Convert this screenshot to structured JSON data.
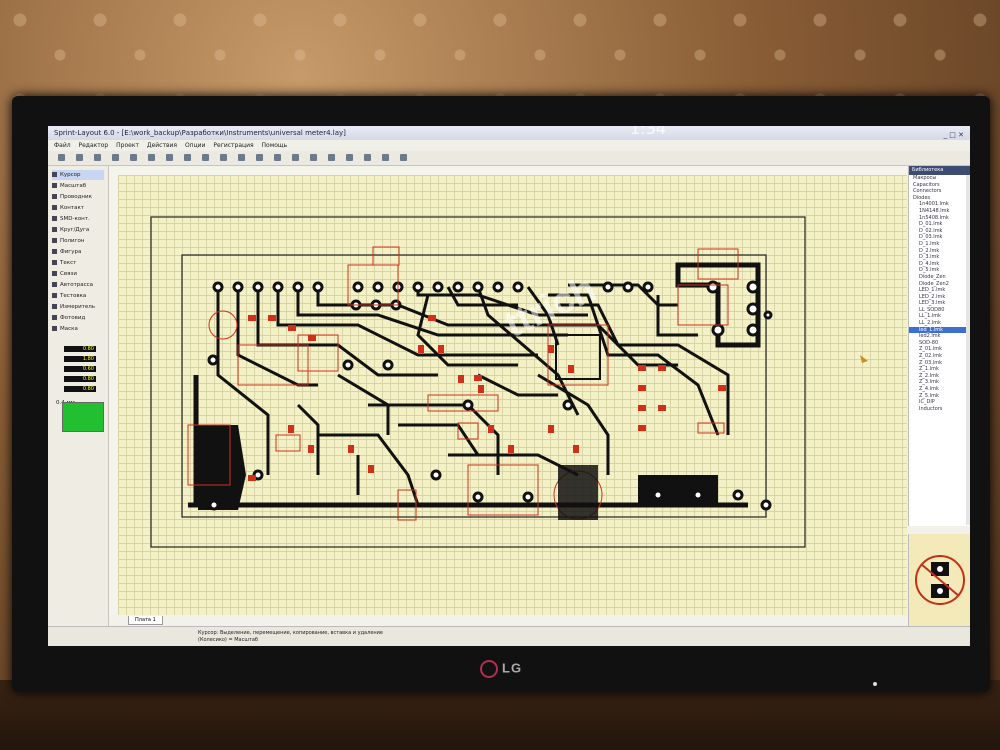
{
  "window": {
    "title": "Sprint-Layout 6.0 - [E:\\work_backup\\Разработки\\Instruments\\universal meter4.lay]",
    "clock": "1:34",
    "controls": "_ □ ✕"
  },
  "menu": [
    "Файл",
    "Редактор",
    "Проект",
    "Действия",
    "Опции",
    "Регистрация",
    "Помощь"
  ],
  "toolbar": {
    "icons": [
      "new-icon",
      "open-icon",
      "save-icon",
      "print-icon",
      "undo-icon",
      "redo-icon",
      "cut-icon",
      "copy-icon",
      "paste-icon",
      "delete-icon",
      "rotate-icon",
      "mirror-icon",
      "align-icon",
      "group-icon",
      "zoom-icon",
      "layer-icon",
      "grid-icon",
      "photo-icon",
      "info-icon",
      "settings-icon"
    ]
  },
  "tools": [
    {
      "label": "Курсор",
      "icon": "cursor-icon",
      "active": true
    },
    {
      "label": "Масштаб",
      "icon": "zoom-icon"
    },
    {
      "label": "Проводник",
      "icon": "track-icon"
    },
    {
      "label": "Контакт",
      "icon": "pad-icon"
    },
    {
      "label": "SMD-конт.",
      "icon": "smd-icon"
    },
    {
      "label": "Круг/Дуга",
      "icon": "circle-icon"
    },
    {
      "label": "Полигон",
      "icon": "polygon-icon"
    },
    {
      "label": "Фигура",
      "icon": "shape-icon"
    },
    {
      "label": "Текст",
      "icon": "text-icon"
    },
    {
      "label": "Связи",
      "icon": "connection-icon"
    },
    {
      "label": "Автотрасса",
      "icon": "autoroute-icon"
    },
    {
      "label": "Тестовка",
      "icon": "test-icon"
    },
    {
      "label": "Измеритель",
      "icon": "measure-icon"
    },
    {
      "label": "Фотовид",
      "icon": "photoview-icon"
    },
    {
      "label": "Маска",
      "icon": "mask-icon"
    }
  ],
  "grid_label": "0.4 мм",
  "fields": [
    "0.80",
    "1.80",
    "0.60",
    "0.80",
    "0.80"
  ],
  "layer_color": "#22c030",
  "page_tab": "Плата 1",
  "status": {
    "hint_line1": "Курсор: Выделение, перемещение, копирование, вставка и удаление",
    "hint_line2": "(Колесико) = Масштаб"
  },
  "library": {
    "header": "Библиотека",
    "items": [
      "Макросы",
      "Capacitors",
      "Connectors",
      "Diodes",
      "1n4001.lmk",
      "1N4148.lmk",
      "1n5408.lmk",
      "D_01.lmk",
      "D_02.lmk",
      "D_03.lmk",
      "D_1.lmk",
      "D_2.lmk",
      "D_3.lmk",
      "D_4.lmk",
      "D_5.lmk",
      "Diode_Zen",
      "Diode_Zen2",
      "LED_1.lmk",
      "LED_2.lmk",
      "LED_3.lmk",
      "LL_SOD80",
      "LL_1.lmk",
      "LL_2.lmk",
      "led_1.lmk",
      "led2.lmk",
      "SOD-80",
      "Z_01.lmk",
      "Z_02.lmk",
      "Z_03.lmk",
      "Z_1.lmk",
      "Z_2.lmk",
      "Z_3.lmk",
      "Z_4.lmk",
      "Z_5.lmk",
      "IC_DIP",
      "Inductors"
    ],
    "selected_index": 23
  },
  "monitor_brand": "LG",
  "watermark": "ttrich"
}
